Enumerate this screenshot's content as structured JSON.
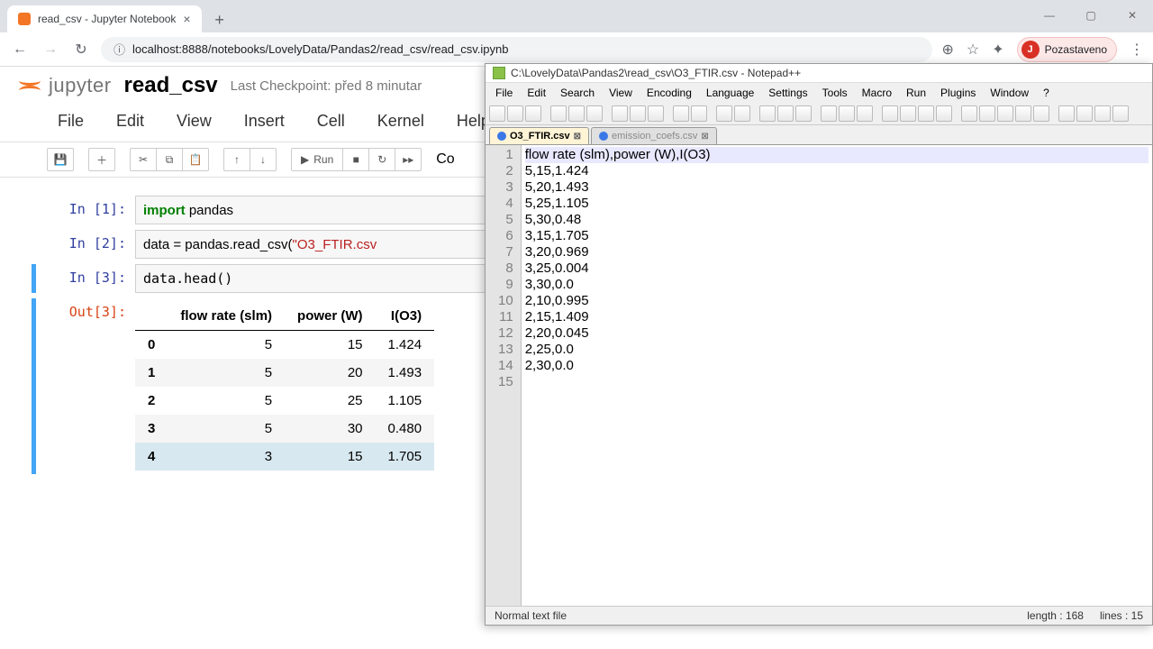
{
  "browser": {
    "tab_title": "read_csv - Jupyter Notebook",
    "new_tab": "+",
    "url": "localhost:8888/notebooks/LovelyData/Pandas2/read_csv/read_csv.ipynb",
    "profile": {
      "initial": "J",
      "label": "Pozastaveno"
    },
    "win": {
      "min": "—",
      "max": "▢",
      "close": "✕"
    }
  },
  "jupyter": {
    "logo_text": "jupyter",
    "title": "read_csv",
    "checkpoint": "Last Checkpoint: před 8 minutar",
    "menus": [
      "File",
      "Edit",
      "View",
      "Insert",
      "Cell",
      "Kernel",
      "Help"
    ],
    "toolbar": {
      "run_label": "Run",
      "code_label": "Co"
    },
    "prompts": {
      "in1": "In [1]:",
      "in2": "In [2]:",
      "in3": "In [3]:",
      "out3": "Out[3]:"
    },
    "cells": {
      "c1": {
        "kw": "import",
        "rest": " pandas"
      },
      "c2_pre": "data = pandas.read_csv(",
      "c2_str": "\"O3_FTIR.csv",
      "c3": "data.head()"
    },
    "table": {
      "cols": [
        "flow rate (slm)",
        "power (W)",
        "I(O3)"
      ],
      "rows": [
        {
          "idx": "0",
          "flow": "5",
          "power": "15",
          "i": "1.424"
        },
        {
          "idx": "1",
          "flow": "5",
          "power": "20",
          "i": "1.493"
        },
        {
          "idx": "2",
          "flow": "5",
          "power": "25",
          "i": "1.105"
        },
        {
          "idx": "3",
          "flow": "5",
          "power": "30",
          "i": "0.480"
        },
        {
          "idx": "4",
          "flow": "3",
          "power": "15",
          "i": "1.705"
        }
      ]
    }
  },
  "npp": {
    "title": "C:\\LovelyData\\Pandas2\\read_csv\\O3_FTIR.csv - Notepad++",
    "menus": [
      "File",
      "Edit",
      "Search",
      "View",
      "Encoding",
      "Language",
      "Settings",
      "Tools",
      "Macro",
      "Run",
      "Plugins",
      "Window",
      "?"
    ],
    "tabs": [
      {
        "name": "O3_FTIR.csv",
        "active": true
      },
      {
        "name": "emission_coefs.csv",
        "active": false
      }
    ],
    "lines": [
      "flow rate (slm),power (W),I(O3)",
      "5,15,1.424",
      "5,20,1.493",
      "5,25,1.105",
      "5,30,0.48",
      "3,15,1.705",
      "3,20,0.969",
      "3,25,0.004",
      "3,30,0.0",
      "2,10,0.995",
      "2,15,1.409",
      "2,20,0.045",
      "2,25,0.0",
      "2,30,0.0",
      ""
    ],
    "status": {
      "left": "Normal text file",
      "length": "length : 168",
      "lines": "lines : 15"
    }
  }
}
